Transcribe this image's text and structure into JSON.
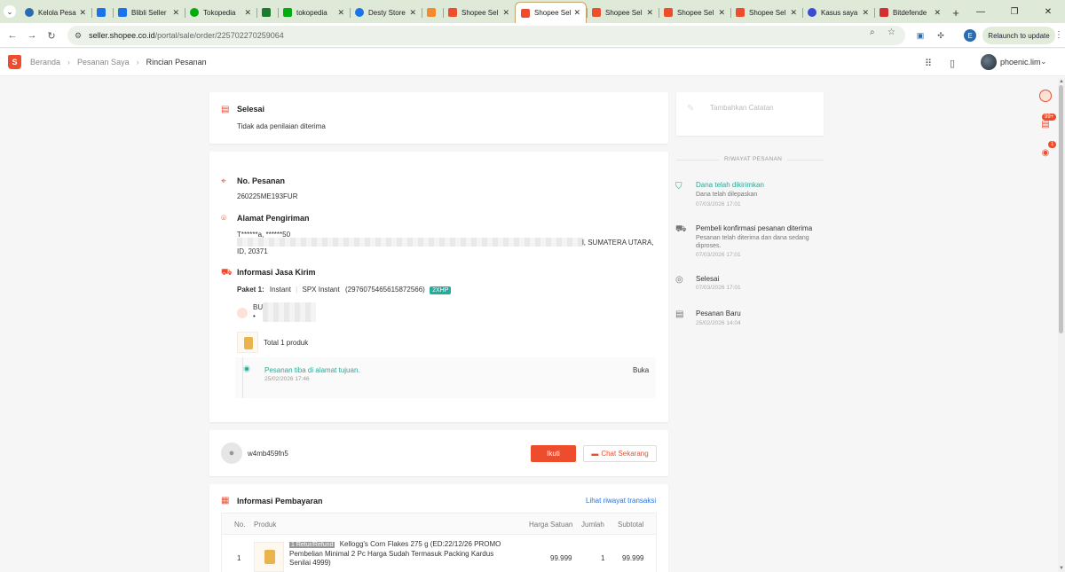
{
  "browser": {
    "tabs": [
      {
        "title": "Kelola Pesan",
        "color": "#2b6cb0"
      },
      {
        "title": "",
        "color": "#1a73e8"
      },
      {
        "title": "Blibli Seller",
        "color": "#1a73e8"
      },
      {
        "title": "Tokopedia",
        "color": "#03ac0e"
      },
      {
        "title": "",
        "color": "#1a7a2e"
      },
      {
        "title": "tokopedia",
        "color": "#03ac0e"
      },
      {
        "title": "Desty Store",
        "color": "#1a73e8"
      },
      {
        "title": "",
        "color": "#f28b30"
      },
      {
        "title": "Shopee Sel",
        "color": "#ee4d2d"
      },
      {
        "title": "Shopee Sel",
        "color": "#ee4d2d"
      },
      {
        "title": "Shopee Sel",
        "color": "#ee4d2d"
      },
      {
        "title": "Shopee Sel",
        "color": "#ee4d2d"
      },
      {
        "title": "Shopee Sel",
        "color": "#ee4d2d"
      },
      {
        "title": "Kasus saya",
        "color": "#3a4bd6"
      },
      {
        "title": "Bitdefende",
        "color": "#d32f2f"
      }
    ],
    "url_host": "seller.shopee.co.id",
    "url_path": "/portal/sale/order/225702270259064",
    "relaunch_label": "Relaunch to update",
    "profile_letter": "E"
  },
  "header": {
    "breadcrumb": [
      "Beranda",
      "Pesanan Saya",
      "Rincian Pesanan"
    ],
    "username": "phoenic.lim"
  },
  "rail": {
    "chat_badge": "99+",
    "notif_badge": "1"
  },
  "status_card": {
    "title": "Selesai",
    "subtitle": "Tidak ada penilaian diterima"
  },
  "order_card": {
    "order_no_label": "No. Pesanan",
    "order_no": "260225ME193FUR",
    "address_label": "Alamat Pengiriman",
    "address_line1": "T******a, ******50",
    "address_tail": "l, SUMATERA UTARA,",
    "address_line3": "ID, 20371",
    "shipping_label": "Informasi Jasa Kirim",
    "package_label": "Paket 1:",
    "package_service": "Instant",
    "package_courier": "SPX Instant",
    "package_tracking": "(2976075465615872566)",
    "package_badge": "2XHP",
    "buyer_short": "BU",
    "buyer_dot": "•",
    "total_product": "Total 1 produk",
    "tracking_status": "Pesanan tiba di alamat tujuan.",
    "tracking_date": "25/02/2026 17:46",
    "tracking_toggle": "Buka"
  },
  "seller_card": {
    "name": "w4mb459fn5",
    "follow_label": "Ikuti",
    "chat_label": "Chat Sekarang"
  },
  "payment_card": {
    "title": "Informasi Pembayaran",
    "history_link": "Lihat riwayat transaksi",
    "columns": [
      "No.",
      "Produk",
      "Harga Satuan",
      "Jumlah",
      "Subtotal"
    ],
    "rows": [
      {
        "no": "1",
        "tag": "1 Retur/Refund",
        "name": "Kellogg's Corn Flakes 275 g (ED:22/12/26 PROMO Pembelian Minimal 2 Pc Harga Sudah Termasuk Packing Kardus Senilai 4999)",
        "price": "99.999",
        "qty": "1",
        "subtotal": "99.999"
      }
    ]
  },
  "notes_card": {
    "placeholder": "Tambahkan Catatan"
  },
  "history": {
    "title": "RIWAYAT PESANAN",
    "items": [
      {
        "title": "Dana telah dikirimkan",
        "sub": "Dana telah dilepaskan",
        "date": "07/03/2026 17:01",
        "active": true
      },
      {
        "title": "Pembeli konfirmasi pesanan diterima",
        "sub": "Pesanan telah diterima dan dana sedang diproses.",
        "date": "07/03/2026 17:01",
        "active": false
      },
      {
        "title": "Selesai",
        "sub": "",
        "date": "07/03/2026 17:01",
        "active": false
      },
      {
        "title": "Pesanan Baru",
        "sub": "",
        "date": "25/02/2026 14:04",
        "active": false
      }
    ]
  },
  "colors": {
    "brand": "#ee4d2d",
    "success": "#26aa99",
    "link": "#2673dd"
  }
}
